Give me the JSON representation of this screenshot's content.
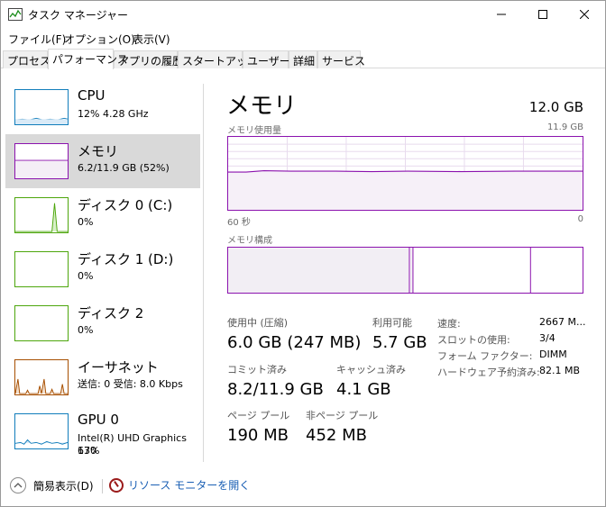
{
  "window": {
    "title": "タスク マネージャー",
    "controls": {
      "minimize": "—",
      "maximize": "☐",
      "close": "✕"
    }
  },
  "menu": [
    "ファイル(F)",
    "オプション(O)",
    "表示(V)"
  ],
  "tabs": [
    {
      "label": "プロセス",
      "active": false
    },
    {
      "label": "パフォーマンス",
      "active": true
    },
    {
      "label": "アプリの履歴",
      "active": false
    },
    {
      "label": "スタートアップ",
      "active": false
    },
    {
      "label": "ユーザー",
      "active": false
    },
    {
      "label": "詳細",
      "active": false
    },
    {
      "label": "サービス",
      "active": false
    }
  ],
  "sidebar": {
    "items": [
      {
        "title": "CPU",
        "sub": "12%  4.28 GHz",
        "sub2": "",
        "color": "#117dbb",
        "selected": false
      },
      {
        "title": "メモリ",
        "sub": "6.2/11.9 GB (52%)",
        "sub2": "",
        "color": "#8b12ae",
        "selected": true
      },
      {
        "title": "ディスク 0 (C:)",
        "sub": "0%",
        "sub2": "",
        "color": "#4da60c",
        "selected": false
      },
      {
        "title": "ディスク 1 (D:)",
        "sub": "0%",
        "sub2": "",
        "color": "#4da60c",
        "selected": false
      },
      {
        "title": "ディスク 2",
        "sub": "0%",
        "sub2": "",
        "color": "#4da60c",
        "selected": false
      },
      {
        "title": "イーサネット",
        "sub": "送信: 0  受信: 8.0 Kbps",
        "sub2": "",
        "color": "#a74f01",
        "selected": false
      },
      {
        "title": "GPU 0",
        "sub": "Intel(R) UHD Graphics 630",
        "sub2": "17%",
        "color": "#117dbb",
        "selected": false
      }
    ]
  },
  "main": {
    "title": "メモリ",
    "total": "12.0 GB",
    "usage_label": "メモリ使用量",
    "usage_max": "11.9 GB",
    "axis_left": "60 秒",
    "axis_right": "0",
    "usage_fraction": 0.52,
    "composition_label": "メモリ構成",
    "stats": {
      "in_use_label": "使用中 (圧縮)",
      "in_use_value": "6.0 GB (247 MB)",
      "available_label": "利用可能",
      "available_value": "5.7 GB",
      "committed_label": "コミット済み",
      "committed_value": "8.2/11.9 GB",
      "cached_label": "キャッシュ済み",
      "cached_value": "4.1 GB",
      "paged_label": "ページ プール",
      "paged_value": "190 MB",
      "nonpaged_label": "非ページ プール",
      "nonpaged_value": "452 MB"
    },
    "specs": {
      "speed_label": "速度:",
      "speed_value": "2667 M...",
      "slots_label": "スロットの使用:",
      "slots_value": "3/4",
      "form_label": "フォーム ファクター:",
      "form_value": "DIMM",
      "reserved_label": "ハードウェア予約済み:",
      "reserved_value": "82.1 MB"
    }
  },
  "footer": {
    "fewer_details": "簡易表示(D)",
    "resource_monitor": "リソース モニターを開く"
  },
  "colors": {
    "memory": "#8b12ae",
    "cpu": "#117dbb",
    "disk": "#4da60c",
    "ethernet": "#a74f01"
  }
}
